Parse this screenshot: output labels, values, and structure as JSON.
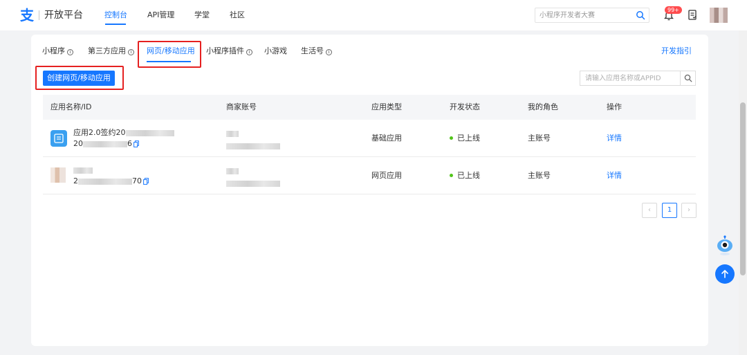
{
  "header": {
    "logo_glyph": "支",
    "logo_text": "开放平台",
    "nav": [
      {
        "label": "控制台",
        "active": true
      },
      {
        "label": "API管理",
        "active": false
      },
      {
        "label": "学堂",
        "active": false
      },
      {
        "label": "社区",
        "active": false
      }
    ],
    "search_placeholder": "小程序开发者大赛",
    "notification_badge": "99+",
    "icons": [
      "search-icon",
      "bell-icon",
      "document-icon",
      "avatar"
    ]
  },
  "tabs": [
    {
      "label": "小程序",
      "info": true,
      "active": false
    },
    {
      "label": "第三方应用",
      "info": true,
      "active": false
    },
    {
      "label": "网页/移动应用",
      "info": false,
      "active": true
    },
    {
      "label": "小程序插件",
      "info": true,
      "active": false
    },
    {
      "label": "小游戏",
      "info": false,
      "active": false
    },
    {
      "label": "生活号",
      "info": true,
      "active": false
    }
  ],
  "dev_guide": "开发指引",
  "create_button": "创建网页/移动应用",
  "app_search_placeholder": "请输入应用名称或APPID",
  "table": {
    "columns": [
      "应用名称/ID",
      "商家账号",
      "应用类型",
      "开发状态",
      "我的角色",
      "操作"
    ],
    "rows": [
      {
        "name_prefix": "应用2.0签约20",
        "id_prefix": "20",
        "id_suffix": "6",
        "app_type": "基础应用",
        "status": "已上线",
        "role": "主账号",
        "action": "详情"
      },
      {
        "name_prefix": "",
        "id_prefix": "2",
        "id_suffix": "70",
        "app_type": "网页应用",
        "status": "已上线",
        "role": "主账号",
        "action": "详情"
      }
    ]
  },
  "pagination": {
    "prev": "‹",
    "current": "1",
    "next": "›"
  },
  "colors": {
    "accent": "#1677ff",
    "status_online": "#52c41a",
    "highlight_box": "#e52020",
    "badge": "#ff4d4f"
  }
}
